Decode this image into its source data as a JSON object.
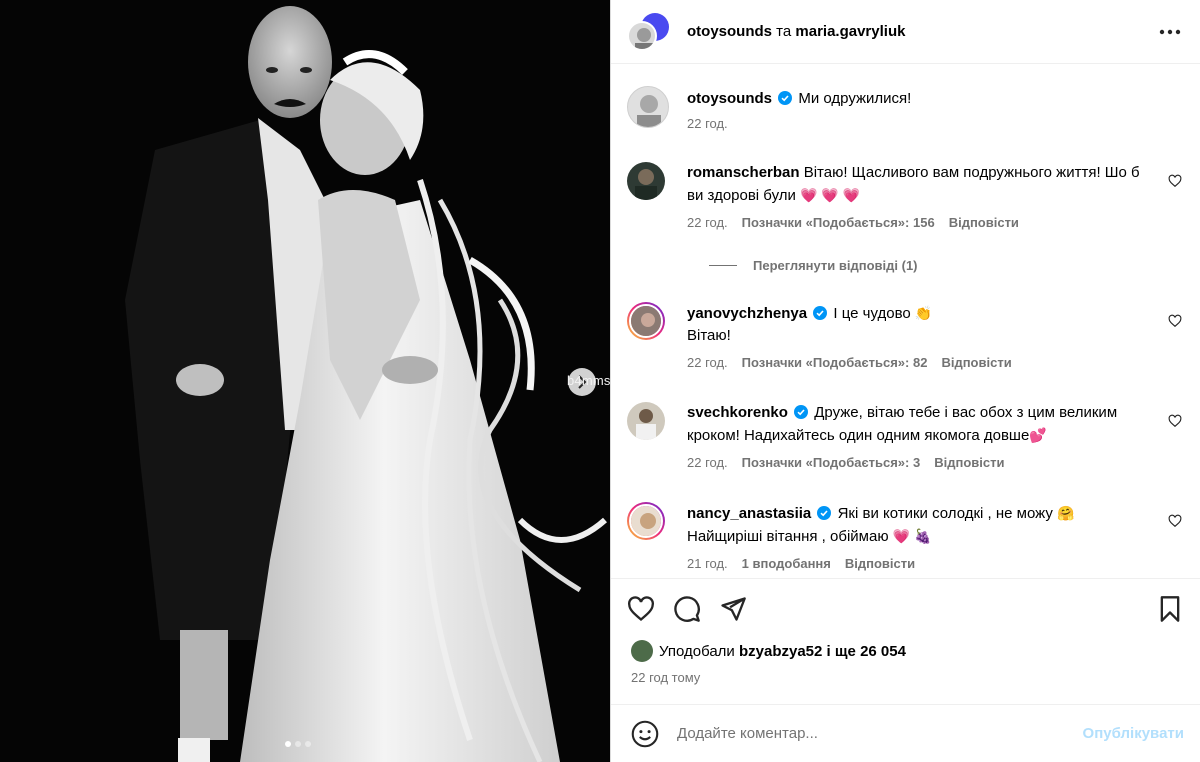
{
  "photo": {
    "watermark": "b4mms",
    "slide_count": 3,
    "active_slide": 1
  },
  "header": {
    "user1": "otoysounds",
    "and": "та",
    "user2": "maria.gavryliuk"
  },
  "caption": {
    "username": "otoysounds",
    "text": "Ми одружилися!",
    "time": "22 год."
  },
  "comments": [
    {
      "username": "romanscherban",
      "text": "Вітаю! Щасливого вам подружнього життя! Шо б ви здорові були",
      "emoji": "💗 💗 💗",
      "time": "22 год.",
      "likes": "Позначки «Подобається»: 156",
      "reply": "Відповісти",
      "view_replies": "Переглянути відповіді (1)"
    },
    {
      "username": "yanovychzhenya",
      "text": "І це чудово",
      "emoji": "👏",
      "text2": "Вітаю!",
      "time": "22 год.",
      "likes": "Позначки «Подобається»: 82",
      "reply": "Відповісти"
    },
    {
      "username": "svechkorenko",
      "text": "Друже, вітаю тебе і вас обох з цим великим кроком! Надихайтесь один одним якомога довше",
      "emoji": "💕",
      "time": "22 год.",
      "likes": "Позначки «Подобається»: 3",
      "reply": "Відповісти"
    },
    {
      "username": "nancy_anastasiia",
      "text": "Які ви котики солодкі , не можу",
      "emoji": "🤗",
      "text2": "Найщиріші вітання , обіймаю",
      "emoji2": "💗 🍇",
      "time": "21 год.",
      "likes": "1 вподобання",
      "reply": "Відповісти"
    }
  ],
  "likes": {
    "prefix": "Уподобали",
    "user": "bzyabzya52",
    "mid": "і ще",
    "count": "26 054"
  },
  "posted": "22 год тому",
  "composer": {
    "placeholder": "Додайте коментар...",
    "publish": "Опублікувати"
  },
  "colors": {
    "verified": "#0095f6",
    "link_disabled": "#b2dffc",
    "secondary_text": "#737373"
  }
}
